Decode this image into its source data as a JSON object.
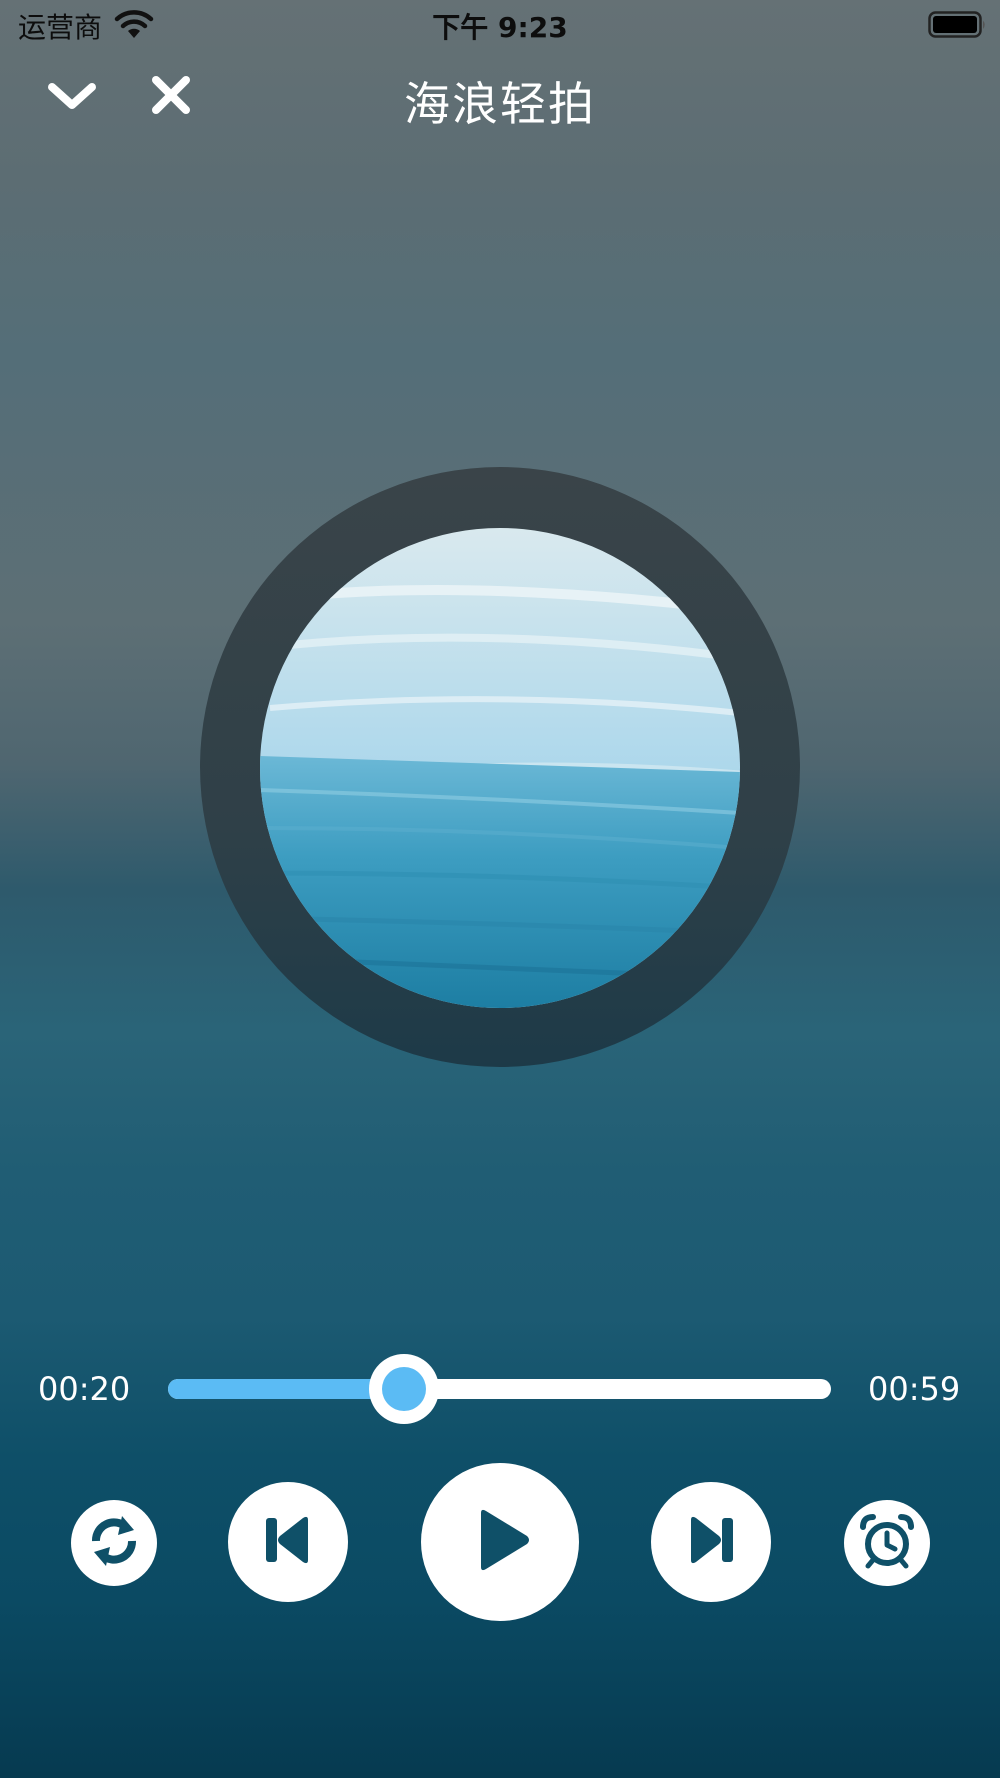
{
  "status_bar": {
    "carrier": "运营商",
    "time": "下午 9:23",
    "wifi_icon": "wifi-icon",
    "battery_icon": "battery-full-icon"
  },
  "nav": {
    "title": "海浪轻拍",
    "collapse_icon": "chevron-down-icon",
    "close_icon": "close-icon"
  },
  "player": {
    "current_time": "00:20",
    "total_time": "00:59",
    "progress": 0.356,
    "controls": [
      "loop-icon",
      "skip-previous-icon",
      "play-icon",
      "skip-next-icon",
      "alarm-clock-icon"
    ]
  },
  "colors": {
    "accent": "#5bbbf4",
    "control_icon": "#0f5068",
    "text": "#ffffff"
  }
}
